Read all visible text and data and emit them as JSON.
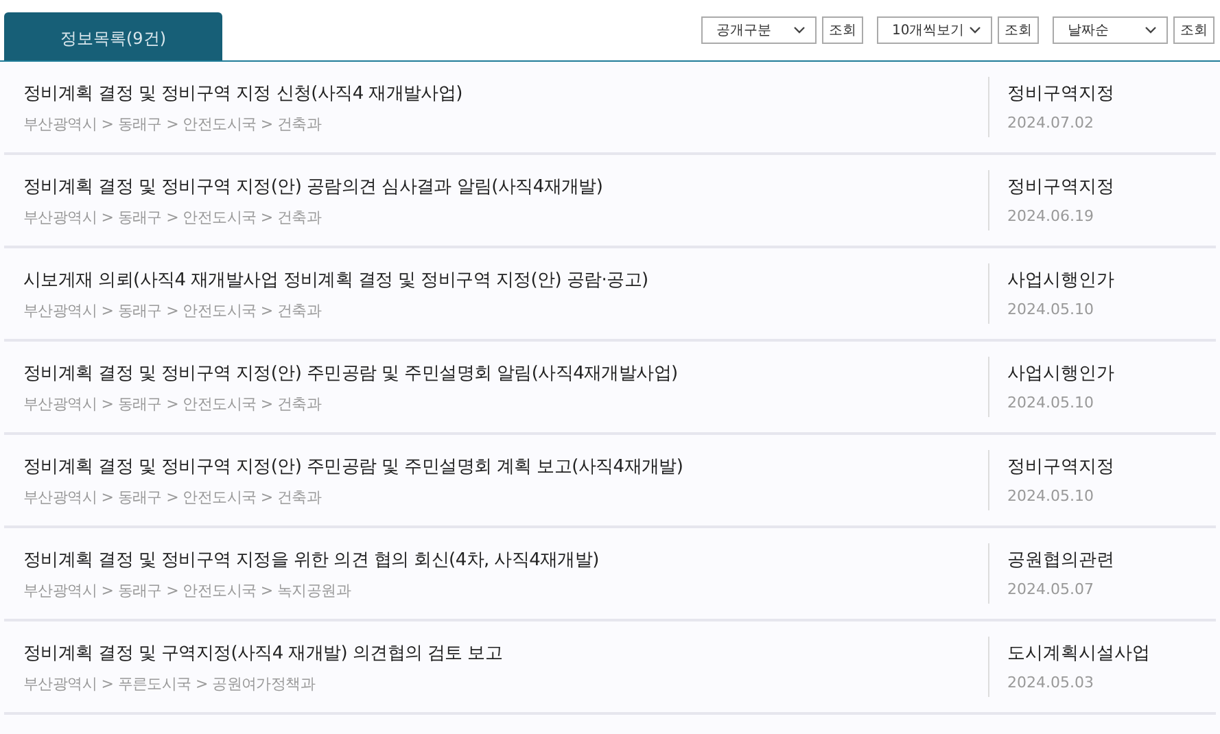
{
  "tab": {
    "label": "정보목록(9건)",
    "selected": true
  },
  "filters": [
    {
      "select": "공개구분",
      "button": "조회"
    },
    {
      "select": "10개씩보기",
      "button": "조회"
    },
    {
      "select": "날짜순",
      "button": "조회"
    }
  ],
  "items": [
    {
      "title": "정비계획 결정 및 정비구역 지정 신청(사직4 재개발사업)",
      "path": "부산광역시 > 동래구 > 안전도시국 > 건축과",
      "category": "정비구역지정",
      "date": "2024.07.02"
    },
    {
      "title": "정비계획 결정 및 정비구역 지정(안) 공람의견 심사결과 알림(사직4재개발)",
      "path": "부산광역시 > 동래구 > 안전도시국 > 건축과",
      "category": "정비구역지정",
      "date": "2024.06.19"
    },
    {
      "title": "시보게재 의뢰(사직4 재개발사업 정비계획 결정 및 정비구역 지정(안) 공람·공고)",
      "path": "부산광역시 > 동래구 > 안전도시국 > 건축과",
      "category": "사업시행인가",
      "date": "2024.05.10"
    },
    {
      "title": "정비계획 결정 및 정비구역 지정(안) 주민공람 및 주민설명회 알림(사직4재개발사업)",
      "path": "부산광역시 > 동래구 > 안전도시국 > 건축과",
      "category": "사업시행인가",
      "date": "2024.05.10"
    },
    {
      "title": "정비계획 결정 및 정비구역 지정(안) 주민공람 및 주민설명회 계획 보고(사직4재개발)",
      "path": "부산광역시 > 동래구 > 안전도시국 > 건축과",
      "category": "정비구역지정",
      "date": "2024.05.10"
    },
    {
      "title": "정비계획 결정 및 정비구역 지정을 위한 의견 협의 회신(4차, 사직4재개발)",
      "path": "부산광역시 > 동래구 > 안전도시국 > 녹지공원과",
      "category": "공원협의관련",
      "date": "2024.05.07"
    },
    {
      "title": "정비계획 결정 및 구역지정(사직4 재개발) 의견협의 검토 보고",
      "path": "부산광역시 > 푸른도시국 > 공원여가정책과",
      "category": "도시계획시설사업",
      "date": "2024.05.03"
    }
  ]
}
